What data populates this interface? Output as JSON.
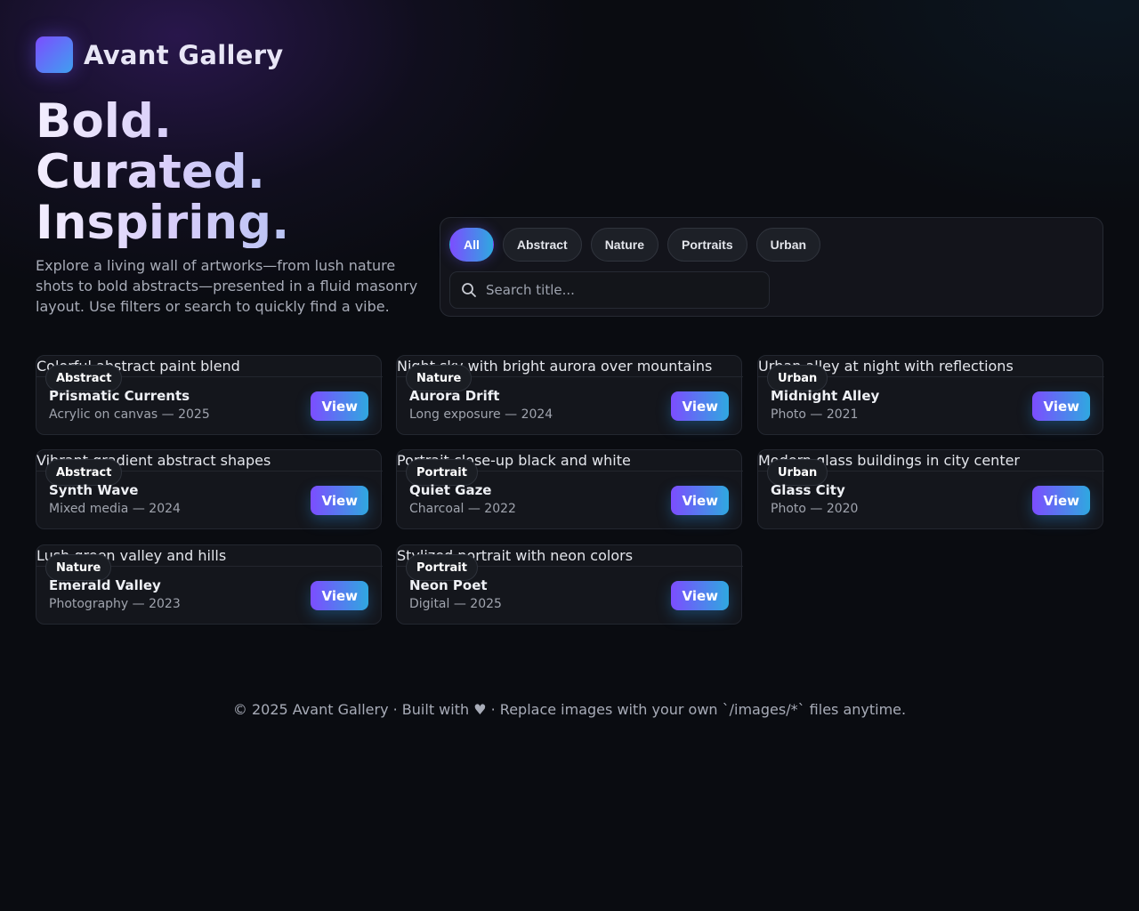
{
  "brand": {
    "name": "Avant Gallery"
  },
  "hero": {
    "line1": "Bold.",
    "line2": "Curated.",
    "line3": "Inspiring."
  },
  "lead": "Explore a living wall of artworks—from lush nature shots to bold abstracts—presented in a fluid masonry layout. Use filters or search to quickly find a vibe.",
  "filters": {
    "chips": [
      "All",
      "Abstract",
      "Nature",
      "Portraits",
      "Urban"
    ],
    "active": "All",
    "search_placeholder": "Search title..."
  },
  "colors": {
    "accent_start": "#7c4dff",
    "accent_end": "#2fa8e0",
    "background": "#0a0c11"
  },
  "cards": [
    {
      "alt": "Colorful abstract paint blend",
      "tag": "Abstract",
      "title": "Prismatic Currents",
      "meta": "Acrylic on canvas — 2025",
      "button": "View"
    },
    {
      "alt": "Night sky with bright aurora over mountains",
      "tag": "Nature",
      "title": "Aurora Drift",
      "meta": "Long exposure — 2024",
      "button": "View"
    },
    {
      "alt": "Urban alley at night with reflections",
      "tag": "Urban",
      "title": "Midnight Alley",
      "meta": "Photo — 2021",
      "button": "View"
    },
    {
      "alt": "Vibrant gradient abstract shapes",
      "tag": "Abstract",
      "title": "Synth Wave",
      "meta": "Mixed media — 2024",
      "button": "View"
    },
    {
      "alt": "Portrait close-up black and white",
      "tag": "Portrait",
      "title": "Quiet Gaze",
      "meta": "Charcoal — 2022",
      "button": "View"
    },
    {
      "alt": "Modern glass buildings in city center",
      "tag": "Urban",
      "title": "Glass City",
      "meta": "Photo — 2020",
      "button": "View"
    },
    {
      "alt": "Lush green valley and hills",
      "tag": "Nature",
      "title": "Emerald Valley",
      "meta": "Photography — 2023",
      "button": "View"
    },
    {
      "alt": "Stylized portrait with neon colors",
      "tag": "Portrait",
      "title": "Neon Poet",
      "meta": "Digital — 2025",
      "button": "View"
    }
  ],
  "footer": "© 2025 Avant Gallery · Built with ♥ · Replace images with your own `/images/*` files anytime."
}
